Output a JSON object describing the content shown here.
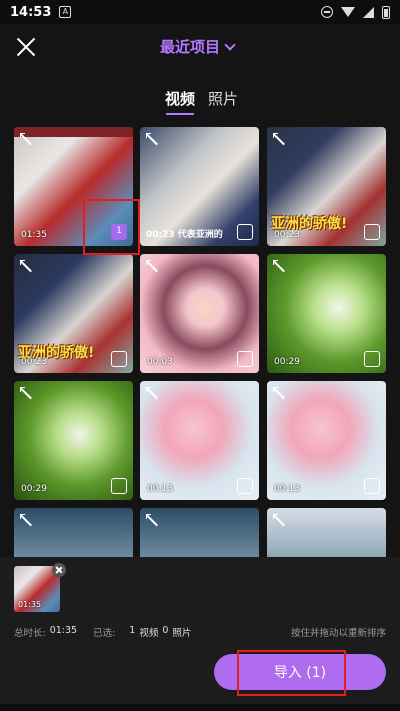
{
  "status_bar": {
    "time": "14:53",
    "notification_glyph": "A"
  },
  "header": {
    "title": "最近项目"
  },
  "tabs": [
    {
      "label": "视频"
    },
    {
      "label": "照片"
    }
  ],
  "grid": {
    "items": [
      {
        "duration": "01:35",
        "selected": true,
        "selected_index": "1"
      },
      {
        "duration": "00:23",
        "caption": "代表亚洲的"
      },
      {
        "duration": "00:23",
        "banner": "亚洲的骄傲!"
      },
      {
        "duration": "00:23",
        "banner": "亚洲的骄傲!"
      },
      {
        "duration": "00:03"
      },
      {
        "duration": "00:29"
      },
      {
        "duration": "00:29"
      },
      {
        "duration": "00:13"
      },
      {
        "duration": "00:13"
      }
    ]
  },
  "selection_panel": {
    "thumb_duration": "01:35",
    "total_label": "总时长:",
    "total_value": "01:35",
    "selected_label": "已选:",
    "video_count": "1",
    "video_label": "视频",
    "photo_count": "0",
    "photo_label": "照片",
    "hint": "按住并拖动以重新排序"
  },
  "import_button": {
    "label": "导入 (1)"
  },
  "colors": {
    "accent": "#b479ff",
    "button": "#b06cf0",
    "highlight_box": "#e02020"
  },
  "icons": [
    "close-icon",
    "chevron-down-icon",
    "expand-icon",
    "checkbox-icon",
    "remove-icon"
  ]
}
